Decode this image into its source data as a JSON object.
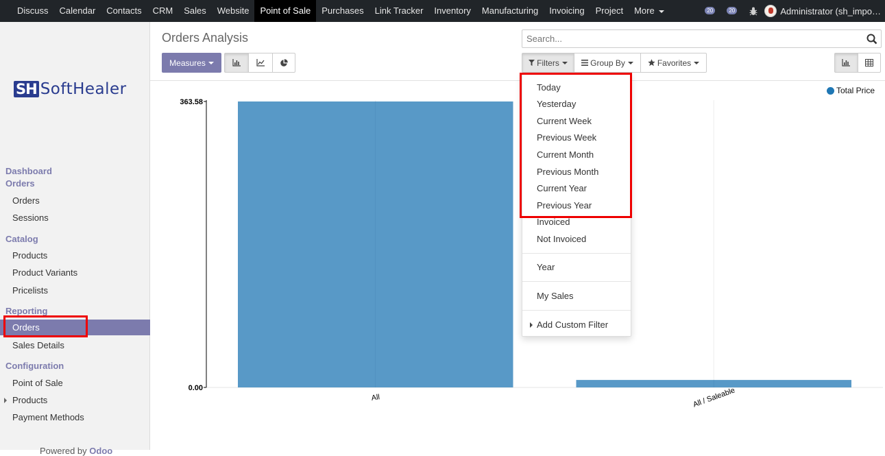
{
  "topbar": {
    "menu": [
      "Discuss",
      "Calendar",
      "Contacts",
      "CRM",
      "Sales",
      "Website",
      "Point of Sale",
      "Purchases",
      "Link Tracker",
      "Inventory",
      "Manufacturing",
      "Invoicing",
      "Project",
      "More"
    ],
    "active": "Point of Sale",
    "activity_count": "20",
    "messages_count": "20",
    "user_name": "Administrator (sh_impo…"
  },
  "sidebar": {
    "logo_mark": "SH",
    "logo_word": "SoftHealer",
    "sections": {
      "dashboard": "Dashboard",
      "orders": "Orders",
      "catalog": "Catalog",
      "reporting": "Reporting",
      "configuration": "Configuration"
    },
    "items": {
      "orders": "Orders",
      "sessions": "Sessions",
      "products": "Products",
      "product_variants": "Product Variants",
      "pricelists": "Pricelists",
      "reporting_orders": "Orders",
      "sales_details": "Sales Details",
      "point_of_sale": "Point of Sale",
      "config_products": "Products",
      "payment_methods": "Payment Methods"
    },
    "powered_prefix": "Powered by",
    "powered_brand": "Odoo"
  },
  "control_panel": {
    "title": "Orders Analysis",
    "search_placeholder": "Search...",
    "measures_label": "Measures",
    "filters_label": "Filters",
    "group_by_label": "Group By",
    "favorites_label": "Favorites"
  },
  "filters_menu": {
    "items": [
      "Today",
      "Yesterday",
      "Current Week",
      "Previous Week",
      "Current Month",
      "Previous Month",
      "Current Year",
      "Previous Year",
      "Invoiced",
      "Not Invoiced"
    ],
    "year": "Year",
    "my_sales": "My Sales",
    "custom": "Add Custom Filter"
  },
  "chart_data": {
    "type": "bar",
    "categories": [
      "All",
      "All / Saleable"
    ],
    "series": [
      {
        "name": "Total Price",
        "values": [
          363.58,
          9.5
        ]
      }
    ],
    "y_tick_labels": [
      "363.58",
      "0.00"
    ],
    "ylim": [
      0,
      363.58
    ],
    "legend": "top-right",
    "color": "#5899c7"
  },
  "colors": {
    "brand": "#7c7bad",
    "navbar": "#212529",
    "highlight": "#e00000"
  }
}
